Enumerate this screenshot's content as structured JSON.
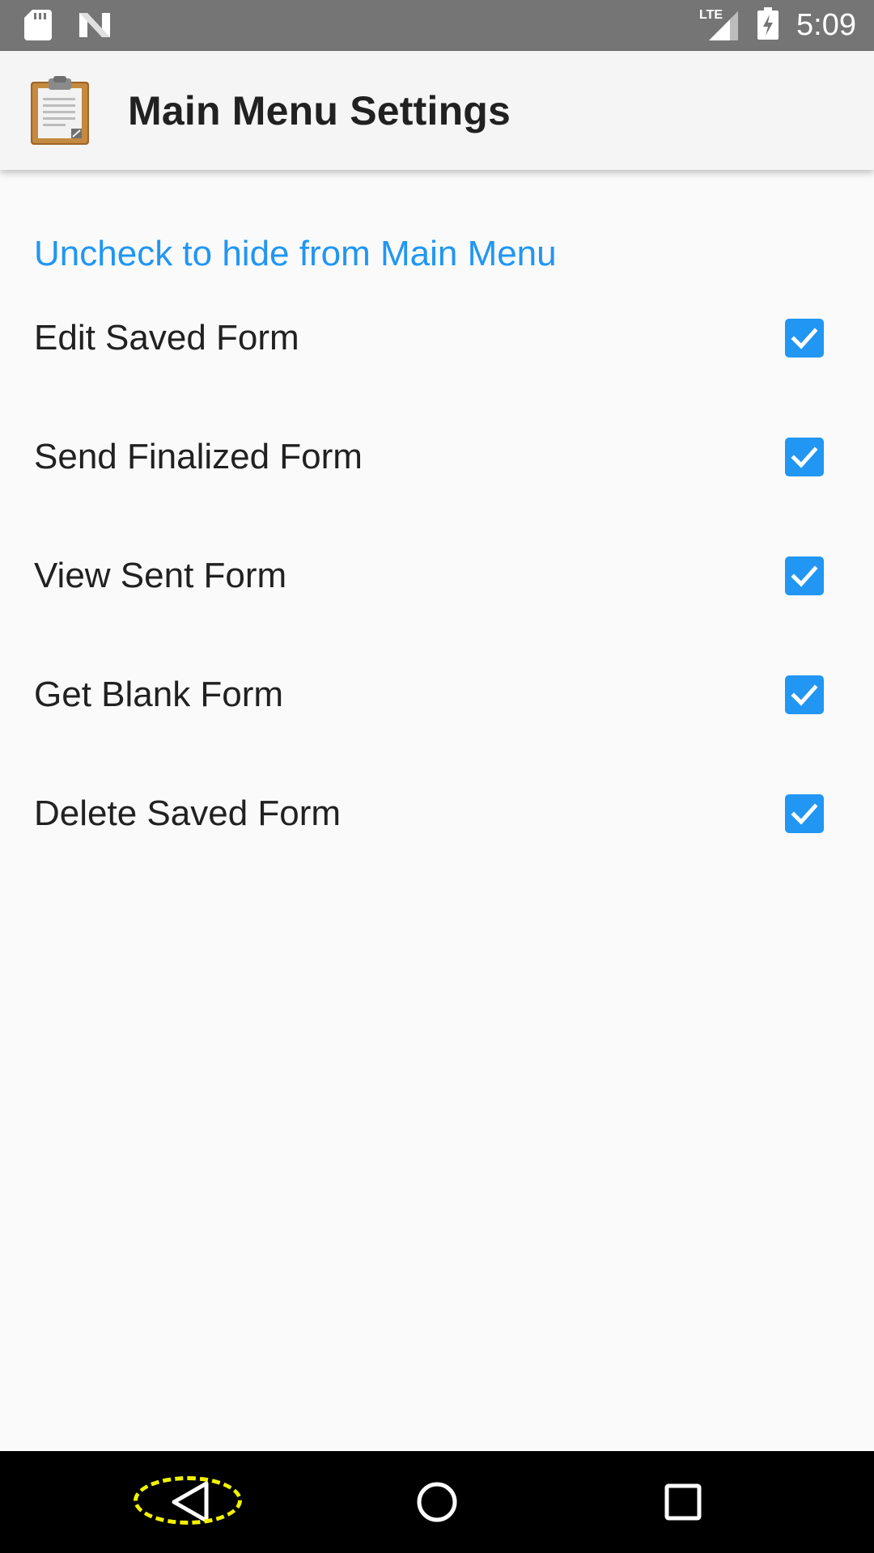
{
  "status_bar": {
    "time": "5:09",
    "network_label": "LTE",
    "icons": [
      "sd-card-icon",
      "n-logo-icon",
      "signal-icon",
      "battery-charging-icon"
    ]
  },
  "app_bar": {
    "title": "Main Menu Settings",
    "icon": "clipboard-icon"
  },
  "section": {
    "header": "Uncheck to hide from Main Menu"
  },
  "preferences": [
    {
      "label": "Edit Saved Form",
      "checked": true
    },
    {
      "label": "Send Finalized Form",
      "checked": true
    },
    {
      "label": "View Sent Form",
      "checked": true
    },
    {
      "label": "Get Blank Form",
      "checked": true
    },
    {
      "label": "Delete Saved Form",
      "checked": true
    }
  ],
  "nav_bar": {
    "buttons": [
      "back-icon",
      "home-icon",
      "recent-apps-icon"
    ],
    "highlighted": "back-icon"
  },
  "colors": {
    "accent": "#2196f3",
    "status_bar": "#757575",
    "app_bar": "#f5f5f5",
    "background": "#fafafa",
    "highlight": "#f2f200"
  }
}
